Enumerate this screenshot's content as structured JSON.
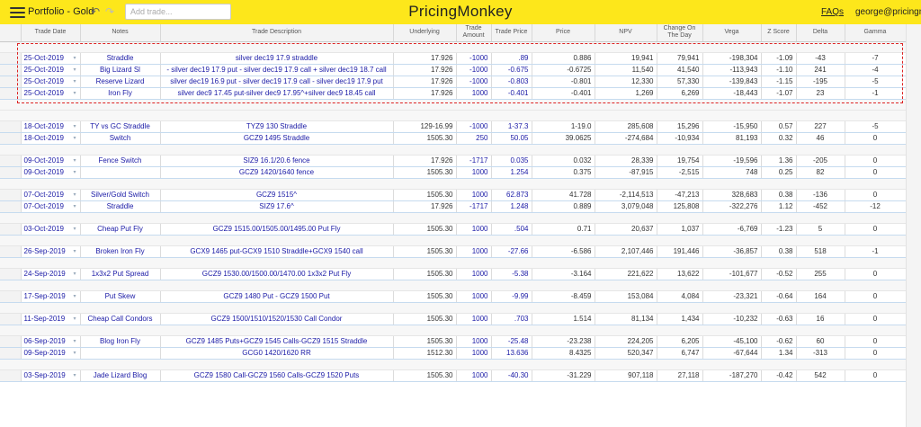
{
  "topbar": {
    "menu_icon": "hamburger-menu-icon",
    "portfolio_label": "Portfolio - Gold",
    "undo_glyph": "↶",
    "redo_glyph": "↷",
    "add_trade_placeholder": "Add trade...",
    "brand": "PricingMonkey",
    "faqs_label": "FAQs",
    "user_label": "george@pricingm",
    "bar_color": "#fde71b"
  },
  "table": {
    "columns": [
      "Trade Date",
      "Notes",
      "Trade Description",
      "Underlying",
      "Trade Amount",
      "Trade Price",
      "Price",
      "NPV",
      "Change On The Day",
      "Vega",
      "Z Score",
      "Delta",
      "Gamma"
    ],
    "highlight_color": "#dd2222",
    "link_color": "#1a1aa6",
    "rows": [
      {
        "type": "spacer"
      },
      {
        "type": "trade",
        "date": "25-Oct-2019",
        "notes": "Straddle",
        "desc": "silver dec19 17.9 straddle",
        "underlying": "17.926",
        "amount": "-1000",
        "tprice": ".89",
        "price": "0.886",
        "npv": "19,941",
        "change": "79,941",
        "vega": "-198,304",
        "z": "-1.09",
        "delta": "-43",
        "gamma": "-7"
      },
      {
        "type": "trade",
        "date": "25-Oct-2019",
        "notes": "Big Lizard Sl",
        "desc": "- silver dec19 17.9 put - silver dec19 17.9 call + silver dec19 18.7 call",
        "underlying": "17.926",
        "amount": "-1000",
        "tprice": "-0.675",
        "price": "-0.6725",
        "npv": "11,540",
        "change": "41,540",
        "vega": "-113,943",
        "z": "-1.10",
        "delta": "241",
        "gamma": "-4"
      },
      {
        "type": "trade",
        "date": "25-Oct-2019",
        "notes": "Reserve Lizard",
        "desc": "silver dec19 16.9 put - silver dec19 17.9 call - silver dec19 17.9 put",
        "underlying": "17.926",
        "amount": "-1000",
        "tprice": "-0.803",
        "price": "-0.801",
        "npv": "12,330",
        "change": "57,330",
        "vega": "-139,843",
        "z": "-1.15",
        "delta": "-195",
        "gamma": "-5"
      },
      {
        "type": "trade",
        "date": "25-Oct-2019",
        "notes": "Iron Fly",
        "desc": "silver dec9 17.45 put-silver dec9 17.95^+silver dec9 18.45 call",
        "underlying": "17.926",
        "amount": "1000",
        "tprice": "-0.401",
        "price": "-0.401",
        "npv": "1,269",
        "change": "6,269",
        "vega": "-18,443",
        "z": "-1.07",
        "delta": "23",
        "gamma": "-1"
      },
      {
        "type": "spacer"
      },
      {
        "type": "spacer"
      },
      {
        "type": "trade",
        "date": "18-Oct-2019",
        "notes": "TY vs GC Straddle",
        "desc": "TYZ9 130 Straddle",
        "underlying": "129-16.99",
        "amount": "-1000",
        "tprice": "1-37.3",
        "price": "1-19.0",
        "npv": "285,608",
        "change": "15,296",
        "vega": "-15,950",
        "z": "0.57",
        "delta": "227",
        "gamma": "-5"
      },
      {
        "type": "trade",
        "date": "18-Oct-2019",
        "notes": "Switch",
        "desc": "GCZ9 1495 Straddle",
        "underlying": "1505.30",
        "amount": "250",
        "tprice": "50.05",
        "price": "39.0625",
        "npv": "-274,684",
        "change": "-10,934",
        "vega": "81,193",
        "z": "0.32",
        "delta": "46",
        "gamma": "0"
      },
      {
        "type": "spacer"
      },
      {
        "type": "trade",
        "date": "09-Oct-2019",
        "notes": "Fence Switch",
        "desc": "SIZ9 16.1/20.6 fence",
        "underlying": "17.926",
        "amount": "-1717",
        "tprice": "0.035",
        "price": "0.032",
        "npv": "28,339",
        "change": "19,754",
        "vega": "-19,596",
        "z": "1.36",
        "delta": "-205",
        "gamma": "0"
      },
      {
        "type": "trade",
        "date": "09-Oct-2019",
        "notes": "",
        "desc": "GCZ9 1420/1640 fence",
        "underlying": "1505.30",
        "amount": "1000",
        "tprice": "1.254",
        "price": "0.375",
        "npv": "-87,915",
        "change": "-2,515",
        "vega": "748",
        "z": "0.25",
        "delta": "82",
        "gamma": "0"
      },
      {
        "type": "spacer"
      },
      {
        "type": "trade",
        "date": "07-Oct-2019",
        "notes": "Silver/Gold Switch",
        "desc": "GCZ9 1515^",
        "underlying": "1505.30",
        "amount": "1000",
        "tprice": "62.873",
        "price": "41.728",
        "npv": "-2,114,513",
        "change": "-47,213",
        "vega": "328,683",
        "z": "0.38",
        "delta": "-136",
        "gamma": "0"
      },
      {
        "type": "trade",
        "date": "07-Oct-2019",
        "notes": "Straddle",
        "desc": "SIZ9 17.6^",
        "underlying": "17.926",
        "amount": "-1717",
        "tprice": "1.248",
        "price": "0.889",
        "npv": "3,079,048",
        "change": "125,808",
        "vega": "-322,276",
        "z": "1.12",
        "delta": "-452",
        "gamma": "-12"
      },
      {
        "type": "spacer"
      },
      {
        "type": "trade",
        "date": "03-Oct-2019",
        "notes": "Cheap Put Fly",
        "desc": "GCZ9 1515.00/1505.00/1495.00 Put Fly",
        "underlying": "1505.30",
        "amount": "1000",
        "tprice": ".504",
        "price": "0.71",
        "npv": "20,637",
        "change": "1,037",
        "vega": "-6,769",
        "z": "-1.23",
        "delta": "5",
        "gamma": "0"
      },
      {
        "type": "spacer"
      },
      {
        "type": "trade",
        "date": "26-Sep-2019",
        "notes": "Broken Iron Fly",
        "desc": "GCX9 1465 put-GCX9 1510 Straddle+GCX9 1540 call",
        "underlying": "1505.30",
        "amount": "1000",
        "tprice": "-27.66",
        "price": "-6.586",
        "npv": "2,107,446",
        "change": "191,446",
        "vega": "-36,857",
        "z": "0.38",
        "delta": "518",
        "gamma": "-1"
      },
      {
        "type": "spacer"
      },
      {
        "type": "trade",
        "date": "24-Sep-2019",
        "notes": "1x3x2 Put Spread",
        "desc": "GCZ9 1530.00/1500.00/1470.00 1x3x2 Put Fly",
        "underlying": "1505.30",
        "amount": "1000",
        "tprice": "-5.38",
        "price": "-3.164",
        "npv": "221,622",
        "change": "13,622",
        "vega": "-101,677",
        "z": "-0.52",
        "delta": "255",
        "gamma": "0"
      },
      {
        "type": "spacer"
      },
      {
        "type": "trade",
        "date": "17-Sep-2019",
        "notes": "Put Skew",
        "desc": "GCZ9 1480 Put - GCZ9 1500 Put",
        "underlying": "1505.30",
        "amount": "1000",
        "tprice": "-9.99",
        "price": "-8.459",
        "npv": "153,084",
        "change": "4,084",
        "vega": "-23,321",
        "z": "-0.64",
        "delta": "164",
        "gamma": "0"
      },
      {
        "type": "spacer"
      },
      {
        "type": "trade",
        "date": "11-Sep-2019",
        "notes": "Cheap Call Condors",
        "desc": "GCZ9 1500/1510/1520/1530 Call Condor",
        "underlying": "1505.30",
        "amount": "1000",
        "tprice": ".703",
        "price": "1.514",
        "npv": "81,134",
        "change": "1,434",
        "vega": "-10,232",
        "z": "-0.63",
        "delta": "16",
        "gamma": "0"
      },
      {
        "type": "spacer"
      },
      {
        "type": "trade",
        "date": "06-Sep-2019",
        "notes": "Blog Iron Fly",
        "desc": "GCZ9 1485 Puts+GCZ9 1545 Calls-GCZ9 1515 Straddle",
        "underlying": "1505.30",
        "amount": "1000",
        "tprice": "-25.48",
        "price": "-23.238",
        "npv": "224,205",
        "change": "6,205",
        "vega": "-45,100",
        "z": "-0.62",
        "delta": "60",
        "gamma": "0"
      },
      {
        "type": "trade",
        "date": "09-Sep-2019",
        "notes": "",
        "desc": "GCG0 1420/1620 RR",
        "underlying": "1512.30",
        "amount": "1000",
        "tprice": "13.636",
        "price": "8.4325",
        "npv": "520,347",
        "change": "6,747",
        "vega": "-67,644",
        "z": "1.34",
        "delta": "-313",
        "gamma": "0"
      },
      {
        "type": "spacer"
      },
      {
        "type": "trade",
        "date": "03-Sep-2019",
        "notes": "Jade Lizard Blog",
        "desc": "GCZ9 1580 Call-GCZ9 1560 Calls-GCZ9 1520 Puts",
        "underlying": "1505.30",
        "amount": "1000",
        "tprice": "-40.30",
        "price": "-31.229",
        "npv": "907,118",
        "change": "27,118",
        "vega": "-187,270",
        "z": "-0.42",
        "delta": "542",
        "gamma": "0"
      }
    ]
  }
}
